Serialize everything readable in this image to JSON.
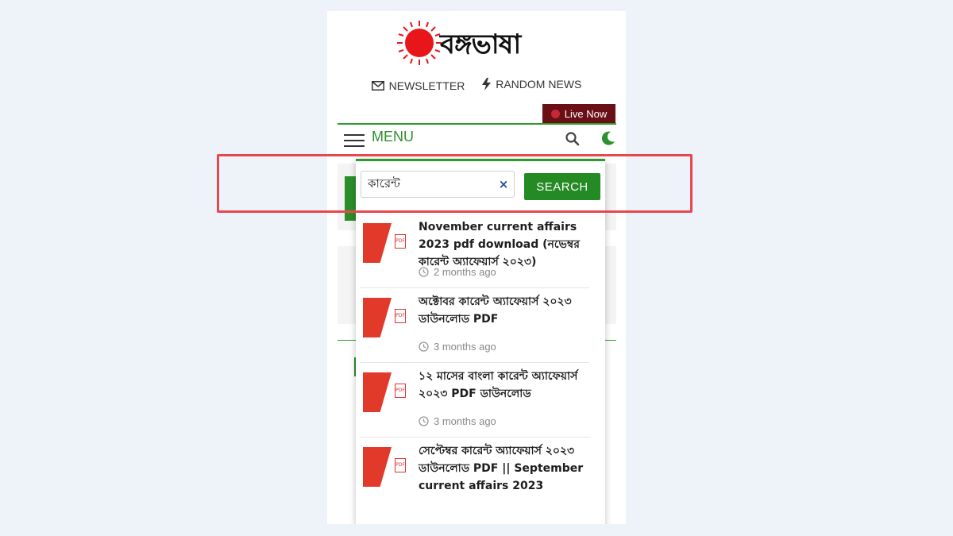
{
  "site": {
    "logo_text": "বঙ্গভাষা"
  },
  "top_links": [
    {
      "label": "NEWSLETTER",
      "icon": "envelope-icon"
    },
    {
      "label": "RANDOM NEWS",
      "icon": "bolt-icon"
    }
  ],
  "live_button": {
    "label": "Live Now"
  },
  "menu": {
    "label": "MENU"
  },
  "search": {
    "value": "কারেন্ট",
    "clear_glyph": "×",
    "button_label": "SEARCH"
  },
  "results": [
    {
      "title": "November current affairs 2023 pdf download (নভেম্বর কারেন্ট অ্যাফেয়ার্স ২০২৩)",
      "time": "2 months ago"
    },
    {
      "title": "অক্টোবর কারেন্ট অ্যাফেয়ার্স ২০২৩ ডাউনলোড PDF",
      "time": "3 months ago"
    },
    {
      "title": "১২ মাসের বাংলা কারেন্ট অ্যাফেয়ার্স ২০২৩ PDF ডাউনলোড",
      "time": "3 months ago"
    },
    {
      "title": "সেপ্টেম্বর কারেন্ট অ্যাফেয়ার্স ২০২৩ ডাউনলোড PDF || September current affairs 2023",
      "time": ""
    }
  ],
  "colors": {
    "accent_green": "#248a24",
    "live_red": "#6a0f16",
    "highlight_red": "#e5484d",
    "logo_sun": "#e8151b"
  }
}
